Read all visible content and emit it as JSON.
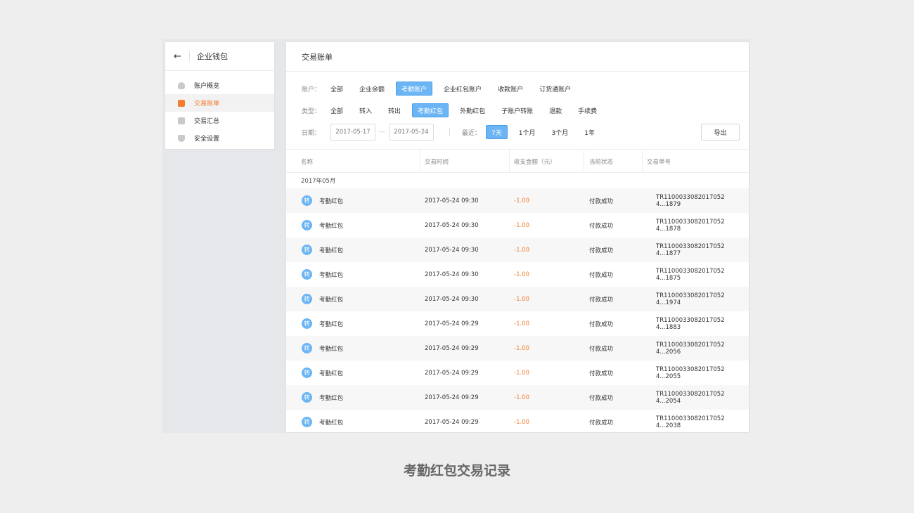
{
  "sidebar": {
    "back_icon": "back-arrow-icon",
    "title": "企业钱包",
    "items": [
      {
        "label": "账户概览",
        "icon": "money-bag-icon",
        "active": false
      },
      {
        "label": "交易账单",
        "icon": "bill-icon",
        "active": true
      },
      {
        "label": "交易汇总",
        "icon": "summary-icon",
        "active": false
      },
      {
        "label": "安全设置",
        "icon": "shield-icon",
        "active": false
      }
    ]
  },
  "main": {
    "title": "交易账单",
    "filters": {
      "account": {
        "label": "账户：",
        "options": [
          "全部",
          "企业余额",
          "考勤账户",
          "企业红包账户",
          "收款账户",
          "订货通账户"
        ],
        "active": "考勤账户"
      },
      "type": {
        "label": "类型：",
        "options": [
          "全部",
          "转入",
          "转出",
          "考勤红包",
          "外勤红包",
          "子账户转账",
          "退款",
          "手续费"
        ],
        "active": "考勤红包"
      },
      "date": {
        "label": "日期：",
        "start": "2017-05-17",
        "separator": "—",
        "end": "2017-05-24",
        "recent_label": "最近：",
        "recent_options": [
          "7天",
          "1个月",
          "3个月",
          "1年"
        ],
        "recent_active": "7天"
      },
      "export_label": "导出"
    },
    "table": {
      "columns": [
        "名称",
        "交易时间",
        "收支金额（元）",
        "当前状态",
        "交易单号"
      ],
      "month": "2017年05月",
      "row_icon_text": "转",
      "rows": [
        {
          "name": "考勤红包",
          "time": "2017-05-24 09:30",
          "amount": "-1.00",
          "status": "付款成功",
          "no": "TR1100033082017052 4...1879"
        },
        {
          "name": "考勤红包",
          "time": "2017-05-24 09:30",
          "amount": "-1.00",
          "status": "付款成功",
          "no": "TR1100033082017052 4...1878"
        },
        {
          "name": "考勤红包",
          "time": "2017-05-24 09:30",
          "amount": "-1.00",
          "status": "付款成功",
          "no": "TR1100033082017052 4...1877"
        },
        {
          "name": "考勤红包",
          "time": "2017-05-24 09:30",
          "amount": "-1.00",
          "status": "付款成功",
          "no": "TR1100033082017052 4...1875"
        },
        {
          "name": "考勤红包",
          "time": "2017-05-24 09:30",
          "amount": "-1.00",
          "status": "付款成功",
          "no": "TR1100033082017052 4...1974"
        },
        {
          "name": "考勤红包",
          "time": "2017-05-24 09:29",
          "amount": "-1.00",
          "status": "付款成功",
          "no": "TR1100033082017052 4...1883"
        },
        {
          "name": "考勤红包",
          "time": "2017-05-24 09:29",
          "amount": "-1.00",
          "status": "付款成功",
          "no": "TR1100033082017052 4...2056"
        },
        {
          "name": "考勤红包",
          "time": "2017-05-24 09:29",
          "amount": "-1.00",
          "status": "付款成功",
          "no": "TR1100033082017052 4...2055"
        },
        {
          "name": "考勤红包",
          "time": "2017-05-24 09:29",
          "amount": "-1.00",
          "status": "付款成功",
          "no": "TR1100033082017052 4...2054"
        },
        {
          "name": "考勤红包",
          "time": "2017-05-24 09:29",
          "amount": "-1.00",
          "status": "付款成功",
          "no": "TR1100033082017052 4...2038"
        }
      ]
    }
  },
  "caption": "考勤红包交易记录",
  "colors": {
    "accent": "#6cb5f5",
    "active_nav": "#f57c2c",
    "amount": "#f57c2c"
  }
}
